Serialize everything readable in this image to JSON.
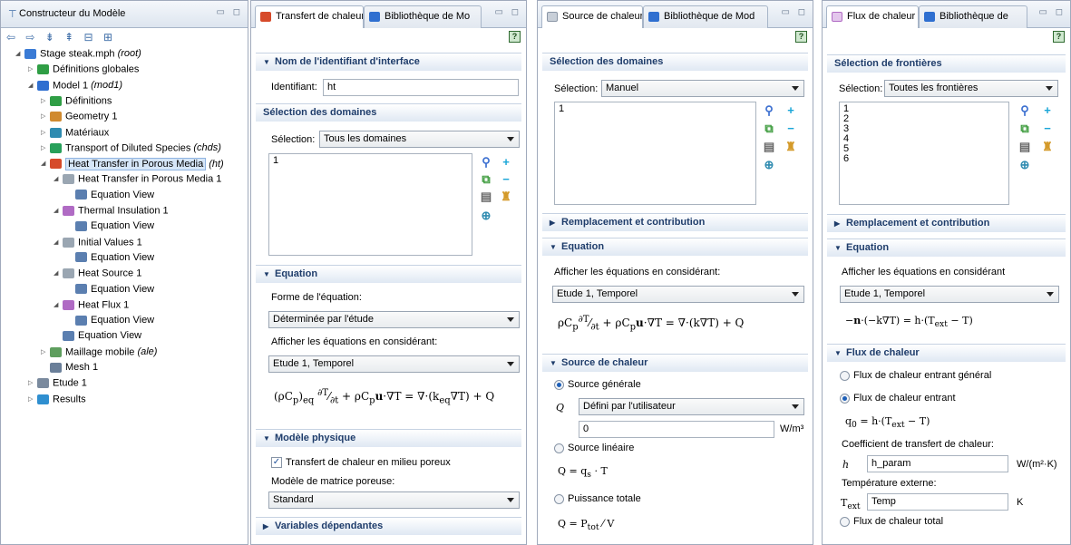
{
  "pane1": {
    "title": "Constructeur du Modèle",
    "nav_icons": "⇦ ⇨ ⇟ ⇞ ⊟ ⊞",
    "tree": [
      {
        "label": "Stage steak.mph",
        "suffix": "(root)",
        "depth": 0,
        "arrow": "◢",
        "icon_color": "#3a7bd5",
        "icon": "root-icon"
      },
      {
        "label": "Définitions globales",
        "suffix": "",
        "depth": 1,
        "arrow": "▷",
        "icon_color": "#2f9e45",
        "icon": "global-definitions-icon"
      },
      {
        "label": "Model 1",
        "suffix": "(mod1)",
        "depth": 1,
        "arrow": "◢",
        "icon_color": "#2f6fd0",
        "icon": "model-icon"
      },
      {
        "label": "Définitions",
        "suffix": "",
        "depth": 2,
        "arrow": "▷",
        "icon_color": "#2f9e45",
        "icon": "definitions-icon"
      },
      {
        "label": "Geometry 1",
        "suffix": "",
        "depth": 2,
        "arrow": "▷",
        "icon_color": "#d08a2f",
        "icon": "geometry-icon"
      },
      {
        "label": "Matériaux",
        "suffix": "",
        "depth": 2,
        "arrow": "▷",
        "icon_color": "#2e8bb0",
        "icon": "materials-icon"
      },
      {
        "label": "Transport of Diluted Species",
        "suffix": "(chds)",
        "depth": 2,
        "arrow": "▷",
        "icon_color": "#27a05a",
        "icon": "transport-icon"
      },
      {
        "label": "Heat Transfer in Porous Media",
        "suffix": "(ht)",
        "depth": 2,
        "arrow": "◢",
        "icon_color": "#d64a2a",
        "icon": "heat-transfer-icon",
        "selected": true
      },
      {
        "label": "Heat Transfer in Porous Media 1",
        "suffix": "",
        "depth": 3,
        "arrow": "◢",
        "icon_color": "#9aa6b2",
        "icon": "feature-icon"
      },
      {
        "label": "Equation View",
        "suffix": "",
        "depth": 4,
        "arrow": "",
        "icon_color": "#5b7fb0",
        "icon": "equation-view-icon"
      },
      {
        "label": "Thermal Insulation 1",
        "suffix": "",
        "depth": 3,
        "arrow": "◢",
        "icon_color": "#b06bc4",
        "icon": "boundary-icon"
      },
      {
        "label": "Equation View",
        "suffix": "",
        "depth": 4,
        "arrow": "",
        "icon_color": "#5b7fb0",
        "icon": "equation-view-icon"
      },
      {
        "label": "Initial Values 1",
        "suffix": "",
        "depth": 3,
        "arrow": "◢",
        "icon_color": "#9aa6b2",
        "icon": "feature-icon"
      },
      {
        "label": "Equation View",
        "suffix": "",
        "depth": 4,
        "arrow": "",
        "icon_color": "#5b7fb0",
        "icon": "equation-view-icon"
      },
      {
        "label": "Heat Source 1",
        "suffix": "",
        "depth": 3,
        "arrow": "◢",
        "icon_color": "#9aa6b2",
        "icon": "feature-icon"
      },
      {
        "label": "Equation View",
        "suffix": "",
        "depth": 4,
        "arrow": "",
        "icon_color": "#5b7fb0",
        "icon": "equation-view-icon"
      },
      {
        "label": "Heat Flux 1",
        "suffix": "",
        "depth": 3,
        "arrow": "◢",
        "icon_color": "#b06bc4",
        "icon": "boundary-icon"
      },
      {
        "label": "Equation View",
        "suffix": "",
        "depth": 4,
        "arrow": "",
        "icon_color": "#5b7fb0",
        "icon": "equation-view-icon"
      },
      {
        "label": "Equation View",
        "suffix": "",
        "depth": 3,
        "arrow": "",
        "icon_color": "#5b7fb0",
        "icon": "equation-view-icon"
      },
      {
        "label": "Maillage mobile",
        "suffix": "(ale)",
        "depth": 2,
        "arrow": "▷",
        "icon_color": "#5e9e5e",
        "icon": "moving-mesh-icon"
      },
      {
        "label": "Mesh 1",
        "suffix": "",
        "depth": 2,
        "arrow": "",
        "icon_color": "#6a7f99",
        "icon": "mesh-icon"
      },
      {
        "label": "Etude 1",
        "suffix": "",
        "depth": 1,
        "arrow": "▷",
        "icon_color": "#7a8a9e",
        "icon": "study-icon"
      },
      {
        "label": "Results",
        "suffix": "",
        "depth": 1,
        "arrow": "▷",
        "icon_color": "#2f8fd0",
        "icon": "results-icon"
      }
    ]
  },
  "pane2": {
    "tab_active": "Transfert de chaleur",
    "tab_inactive": "Bibliothèque de Mo",
    "sec_interface": "Nom de l'identifiant d'interface",
    "identifiant_label": "Identifiant:",
    "identifiant_value": "ht",
    "sec_domains": "Sélection des domaines",
    "selection_label": "Sélection:",
    "selection_value": "Tous les domaines",
    "list_items": [
      "1"
    ],
    "sec_equation": "Equation",
    "forme_label": "Forme de l'équation:",
    "forme_value": "Déterminée par l'étude",
    "afficher_label": "Afficher les équations en considérant:",
    "afficher_value": "Etude 1, Temporel",
    "sec_physical": "Modèle physique",
    "checkbox_label": "Transfert de chaleur en milieu poreux",
    "matrice_label": "Modèle de matrice poreuse:",
    "matrice_value": "Standard",
    "sec_variables": "Variables dépendantes"
  },
  "pane3": {
    "tab_active": "Source de chaleur",
    "tab_inactive": "Bibliothèque de Mod",
    "sec_domains": "Sélection des domaines",
    "selection_label": "Sélection:",
    "selection_value": "Manuel",
    "list_items": [
      "1"
    ],
    "sec_replace": "Remplacement et contribution",
    "sec_equation": "Equation",
    "afficher_label": "Afficher les équations en considérant:",
    "afficher_value": "Etude 1, Temporel",
    "sec_source": "Source de chaleur",
    "radio_general": "Source générale",
    "q_label": "Q",
    "q_select": "Défini par l'utilisateur",
    "q_value": "0",
    "q_unit": "W/m³",
    "radio_linear": "Source linéaire",
    "radio_total": "Puissance totale"
  },
  "pane4": {
    "tab_active": "Flux de chaleur",
    "tab_inactive": "Bibliothèque de",
    "sec_boundaries": "Sélection de frontières",
    "selection_label": "Sélection:",
    "selection_value": "Toutes les frontières",
    "list_items": [
      "1",
      "2",
      "3",
      "4",
      "5",
      "6"
    ],
    "sec_replace": "Remplacement et contribution",
    "sec_equation": "Equation",
    "afficher_label": "Afficher les équations en considérant",
    "afficher_value": "Etude 1, Temporel",
    "sec_flux": "Flux de chaleur",
    "radio_general": "Flux de chaleur entrant général",
    "radio_inward": "Flux de chaleur entrant",
    "coef_label": "Coefficient de transfert de chaleur:",
    "h_label": "h",
    "h_value": "h_param",
    "h_unit": "W/(m²·K)",
    "temp_label": "Température externe:",
    "t_value": "Temp",
    "t_unit": "K",
    "radio_total": "Flux de chaleur total"
  }
}
